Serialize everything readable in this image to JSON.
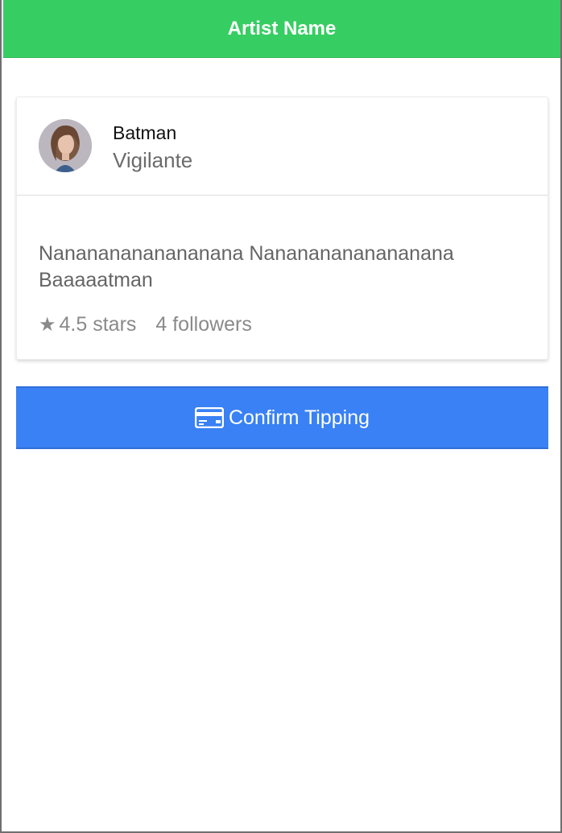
{
  "header": {
    "title": "Artist Name",
    "color": "#36ce62"
  },
  "profile": {
    "name": "Batman",
    "role": "Vigilante",
    "bio": "Nanananananananana Nanananananananana Baaaaatman",
    "rating_icon": "★",
    "rating_text": "4.5 stars",
    "followers_text": "4 followers"
  },
  "action": {
    "confirm_label": "Confirm Tipping",
    "icon": "credit-card-icon",
    "color": "#3981f4"
  }
}
